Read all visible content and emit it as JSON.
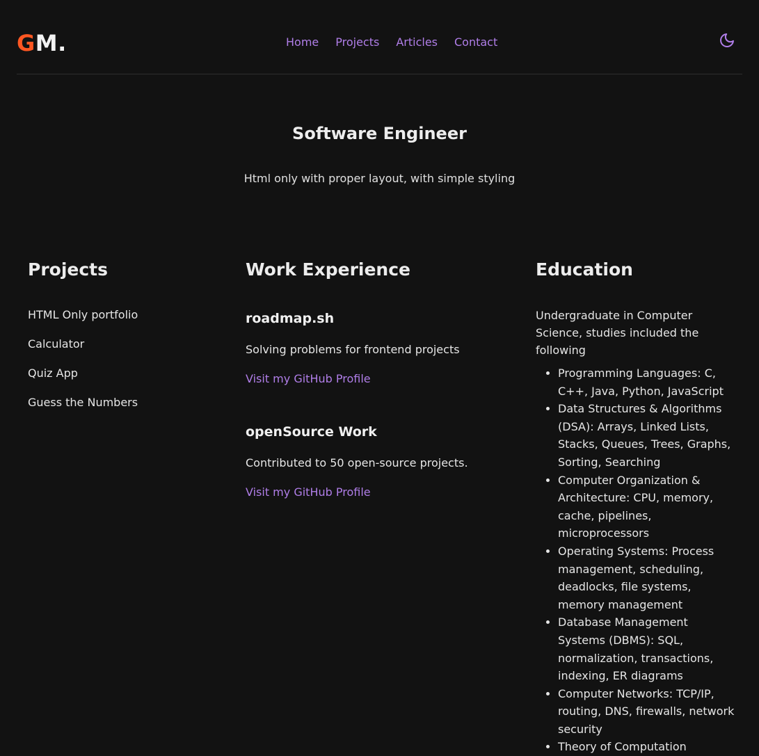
{
  "header": {
    "logo_first": "G",
    "logo_rest": "M.",
    "nav": [
      "Home",
      "Projects",
      "Articles",
      "Contact"
    ],
    "theme_icon": "moon-icon"
  },
  "hero": {
    "title": "Software Engineer",
    "subtitle": "Html only with proper layout, with simple styling"
  },
  "projects": {
    "heading": "Projects",
    "items": [
      "HTML Only portfolio",
      "Calculator",
      "Quiz App",
      "Guess the Numbers"
    ]
  },
  "work": {
    "heading": "Work Experience",
    "jobs": [
      {
        "title": "roadmap.sh",
        "description": "Solving problems for frontend projects",
        "link": "Visit my GitHub Profile"
      },
      {
        "title": "openSource Work",
        "description": "Contributed to 50 open-source projects.",
        "link": "Visit my GitHub Profile"
      }
    ]
  },
  "education": {
    "heading": "Education",
    "intro": "Undergraduate in Computer Science, studies included the following",
    "items": [
      "Programming Languages: C, C++, Java, Python, JavaScript",
      "Data Structures & Algorithms (DSA): Arrays, Linked Lists, Stacks, Queues, Trees, Graphs, Sorting, Searching",
      "Computer Organization & Architecture: CPU, memory, cache, pipelines, microprocessors",
      "Operating Systems: Process management, scheduling, deadlocks, file systems, memory management",
      "Database Management Systems (DBMS): SQL, normalization, transactions, indexing, ER diagrams",
      "Computer Networks: TCP/IP, routing, DNS, firewalls, network security",
      "Theory of Computation"
    ]
  },
  "colors": {
    "background": "#121212",
    "accent": "#b07ee8",
    "logo_accent": "#ff5722"
  }
}
